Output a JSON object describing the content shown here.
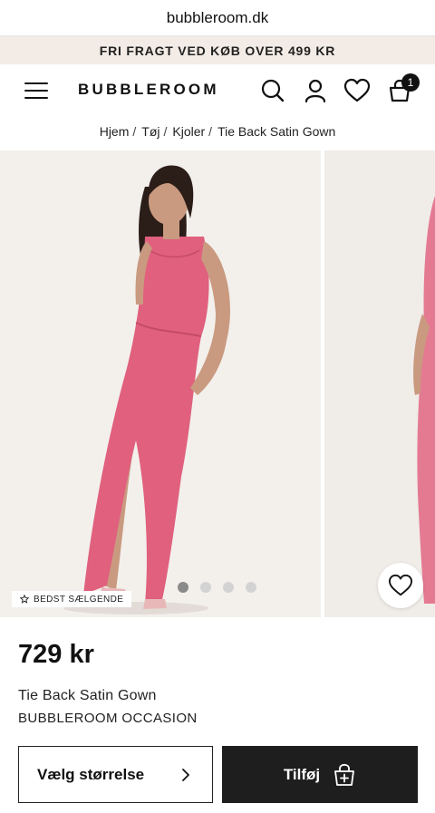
{
  "browser": {
    "url": "bubbleroom.dk"
  },
  "promo": {
    "text": "FRI FRAGT VED KØB OVER 499 KR"
  },
  "header": {
    "logo": "BUBBLEROOM",
    "cart_count": "1"
  },
  "breadcrumb": [
    {
      "label": "Hjem"
    },
    {
      "label": "Tøj"
    },
    {
      "label": "Kjoler"
    },
    {
      "label": "Tie Back Satin Gown"
    }
  ],
  "gallery": {
    "badge": "BEDST SÆLGENDE",
    "slide_count": 4,
    "active_slide": 1
  },
  "product": {
    "price": "729 kr",
    "name": "Tie Back Satin Gown",
    "brand": "BUBBLEROOM OCCASION"
  },
  "actions": {
    "size_label": "Vælg størrelse",
    "add_label": "Tilføj"
  },
  "colors": {
    "dress_pink": "#e0607e",
    "promo_bg": "#f3ece6",
    "button_dark": "#1e1e1e"
  }
}
